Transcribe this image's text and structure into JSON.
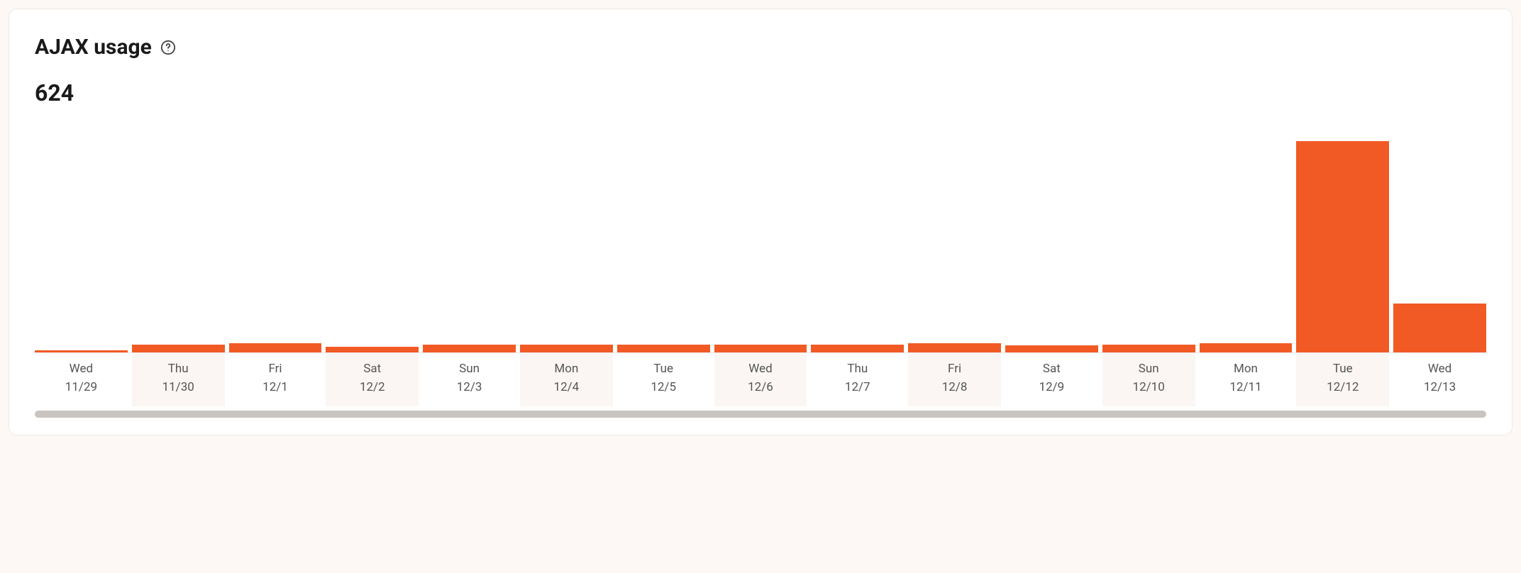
{
  "header": {
    "title": "AJAX usage"
  },
  "total": "624",
  "chart_data": {
    "type": "bar",
    "title": "AJAX usage",
    "xlabel": "",
    "ylabel": "",
    "ylim": [
      0,
      300
    ],
    "categories": [
      {
        "day": "Wed",
        "date": "11/29"
      },
      {
        "day": "Thu",
        "date": "11/30"
      },
      {
        "day": "Fri",
        "date": "12/1"
      },
      {
        "day": "Sat",
        "date": "12/2"
      },
      {
        "day": "Sun",
        "date": "12/3"
      },
      {
        "day": "Mon",
        "date": "12/4"
      },
      {
        "day": "Tue",
        "date": "12/5"
      },
      {
        "day": "Wed",
        "date": "12/6"
      },
      {
        "day": "Thu",
        "date": "12/7"
      },
      {
        "day": "Fri",
        "date": "12/8"
      },
      {
        "day": "Sat",
        "date": "12/9"
      },
      {
        "day": "Sun",
        "date": "12/10"
      },
      {
        "day": "Mon",
        "date": "12/11"
      },
      {
        "day": "Tue",
        "date": "12/12"
      },
      {
        "day": "Wed",
        "date": "12/13"
      }
    ],
    "values": [
      3,
      10,
      12,
      8,
      10,
      10,
      10,
      10,
      10,
      12,
      9,
      10,
      12,
      280,
      65
    ],
    "color": "#f15a24"
  }
}
